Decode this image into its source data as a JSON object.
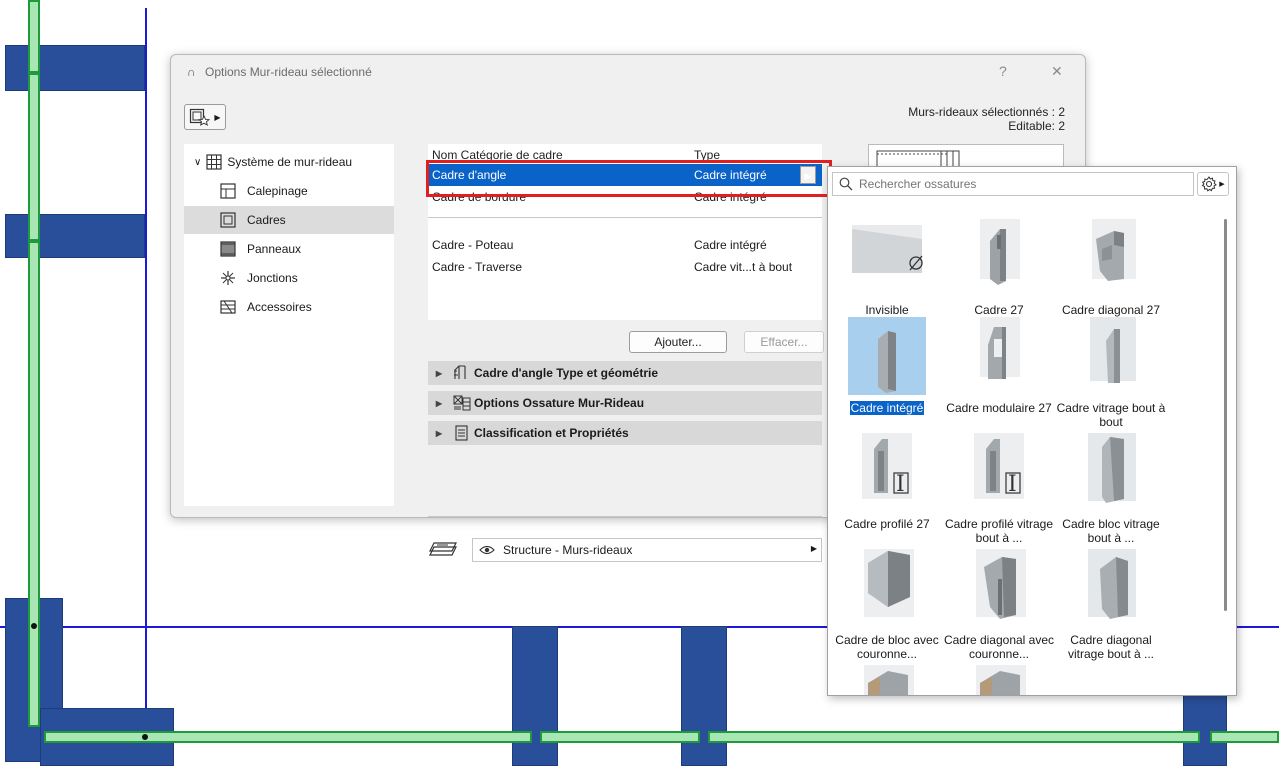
{
  "dialog": {
    "title": "Options Mur-rideau sélectionné",
    "help": "?",
    "close": "✕",
    "selection_count": "Murs-rideaux sélectionnés : 2",
    "editable_count": "Editable: 2"
  },
  "tree": {
    "root_label": "Système de mur-rideau",
    "items": [
      {
        "label": "Calepinage",
        "icon": "grid-layout-icon"
      },
      {
        "label": "Cadres",
        "icon": "frame-icon"
      },
      {
        "label": "Panneaux",
        "icon": "panel-icon"
      },
      {
        "label": "Jonctions",
        "icon": "junction-icon"
      },
      {
        "label": "Accessoires",
        "icon": "accessory-icon"
      }
    ],
    "selected": "Cadres"
  },
  "table": {
    "headers": {
      "name": "Nom Catégorie de cadre",
      "type": "Type"
    },
    "rows_top": [
      {
        "name": "Cadre d'angle",
        "type": "Cadre intégré"
      },
      {
        "name": "Cadre de bordure",
        "type": "Cadre intégré"
      }
    ],
    "rows_bottom": [
      {
        "name": "Cadre - Poteau",
        "type": "Cadre intégré"
      },
      {
        "name": "Cadre - Traverse",
        "type": "Cadre vit...t à bout"
      }
    ]
  },
  "buttons": {
    "add": "Ajouter...",
    "delete": "Effacer..."
  },
  "sections": [
    {
      "label": "Cadre d'angle Type et géométrie",
      "icon": "frame-geometry-icon"
    },
    {
      "label": "Options Ossature Mur-Rideau",
      "icon": "framing-options-icon"
    },
    {
      "label": "Classification et Propriétés",
      "icon": "properties-icon"
    }
  ],
  "layer": {
    "value": "Structure - Murs-rideaux"
  },
  "popup": {
    "search_placeholder": "Rechercher ossatures",
    "items": [
      {
        "label": "Invisible"
      },
      {
        "label": "Cadre 27"
      },
      {
        "label": "Cadre diagonal 27"
      },
      {
        "label": "Cadre intégré"
      },
      {
        "label": "Cadre modulaire 27"
      },
      {
        "label": "Cadre vitrage bout à bout"
      },
      {
        "label": "Cadre profilé 27"
      },
      {
        "label": "Cadre profilé vitrage bout à ..."
      },
      {
        "label": "Cadre bloc vitrage bout à ..."
      },
      {
        "label": "Cadre de bloc avec couronne..."
      },
      {
        "label": "Cadre diagonal avec couronne..."
      },
      {
        "label": "Cadre diagonal vitrage bout à ..."
      }
    ],
    "selected": "Cadre intégré"
  },
  "colors": {
    "selection": "#0a63c9",
    "highlight_box": "#e02020",
    "wall_fill": "#2a4f9a",
    "frame_fill": "#a8e6b4"
  }
}
